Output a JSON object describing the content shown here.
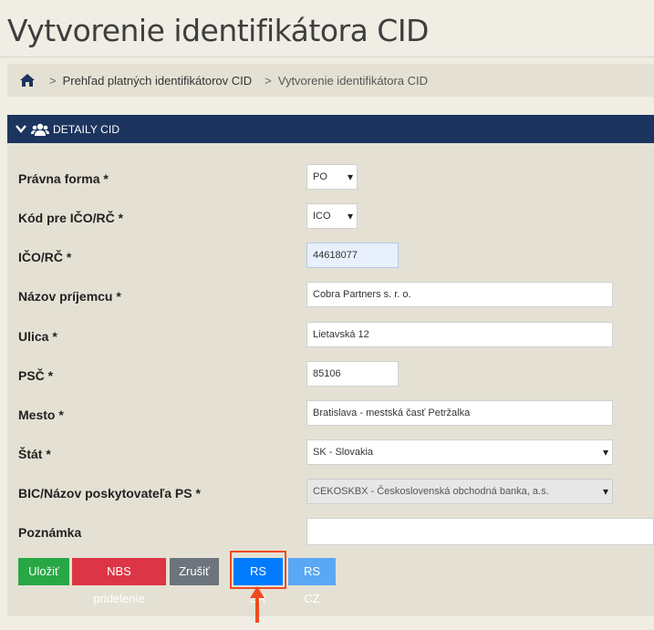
{
  "page": {
    "title": "Vytvorenie identifikátora CID"
  },
  "breadcrumb": {
    "home_icon": "home-icon",
    "separator": ">",
    "items": [
      "Prehľad platných identifikátorov CID",
      "Vytvorenie identifikátora CID"
    ]
  },
  "panel": {
    "title": "DETAILY CID",
    "icons": [
      "chevron-down-icon",
      "users-icon"
    ],
    "header_color": "#1c355e"
  },
  "form": {
    "pravna_forma": {
      "label": "Právna forma *",
      "value": "PO"
    },
    "kod": {
      "label": "Kód pre IČO/RČ *",
      "value": "ICO"
    },
    "ico": {
      "label": "IČO/RČ *",
      "value": "44618077"
    },
    "nazov": {
      "label": "Názov príjemcu *",
      "value": "Cobra Partners s. r. o."
    },
    "ulica": {
      "label": "Ulica *",
      "value": "Lietavská 12"
    },
    "psc": {
      "label": "PSČ *",
      "value": "85106"
    },
    "mesto": {
      "label": "Mesto *",
      "value": "Bratislava - mestská časť Petržalka"
    },
    "stat": {
      "label": "Štát *",
      "value": "SK - Slovakia"
    },
    "bic": {
      "label": "BIC/Názov poskytovateľa PS *",
      "value": "CEKOSKBX - Československá obchodná banka, a.s."
    },
    "poznamka": {
      "label": "Poznámka",
      "value": ""
    }
  },
  "buttons": {
    "save": "Uložiť",
    "nbs": "NBS pridelenie",
    "cancel": "Zrušiť",
    "rs_sr": "RS SR",
    "rs_cz": "RS CZ"
  },
  "colors": {
    "save": "#28a745",
    "nbs": "#dc3545",
    "cancel": "#6c757d",
    "rs_sr": "#007bff",
    "rs_cz": "#5aa8f5",
    "highlight": "#f04a22"
  }
}
